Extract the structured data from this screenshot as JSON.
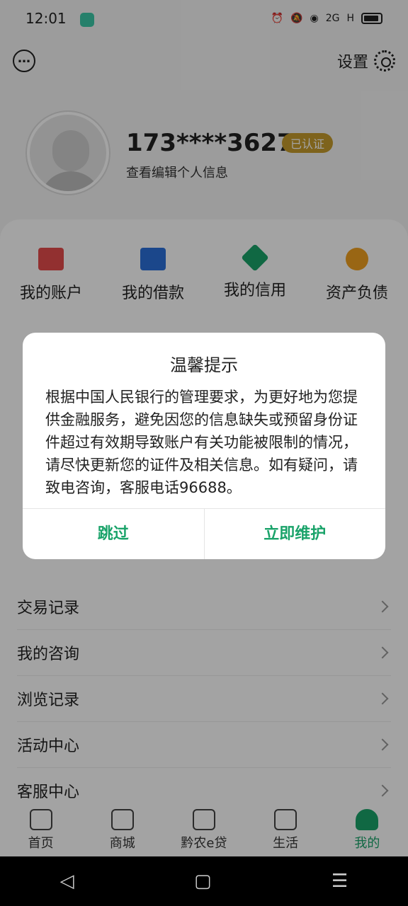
{
  "status": {
    "time": "12:01",
    "net": "2G",
    "signal": "H"
  },
  "header": {
    "settings_label": "设置"
  },
  "profile": {
    "phone": "173****3627",
    "verified": "已认证",
    "edit_info": "查看编辑个人信息"
  },
  "quick": [
    {
      "label": "我的账户",
      "color": "#e44b4b"
    },
    {
      "label": "我的借款",
      "color": "#2b6fd9"
    },
    {
      "label": "我的信用",
      "color": "#1aa36a"
    },
    {
      "label": "资产负债",
      "color": "#f0a020"
    }
  ],
  "list": [
    "交易记录",
    "我的咨询",
    "浏览记录",
    "活动中心",
    "客服中心"
  ],
  "tabs": [
    {
      "label": "首页"
    },
    {
      "label": "商城"
    },
    {
      "label": "黔农e贷"
    },
    {
      "label": "生活"
    },
    {
      "label": "我的"
    }
  ],
  "dialog": {
    "title": "温馨提示",
    "message": "根据中国人民银行的管理要求，为更好地为您提供金融服务，避免因您的信息缺失或预留身份证件超过有效期导致账户有关功能被限制的情况，请尽快更新您的证件及相关信息。如有疑问，请致电咨询，客服电话96688。",
    "skip": "跳过",
    "maintain": "立即维护"
  },
  "nav": {
    "back": "◁",
    "home": "▢",
    "menu": "☰"
  }
}
